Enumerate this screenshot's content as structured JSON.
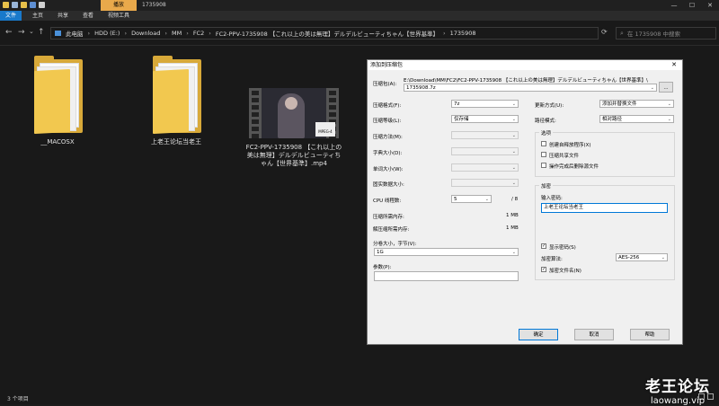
{
  "titlebar": {
    "context_tab": "播放",
    "title": "1735908",
    "minimize": "—",
    "maximize": "☐",
    "close": "✕"
  },
  "ribbon": {
    "tabs": [
      "文件",
      "主页",
      "共享",
      "查看",
      "视频工具"
    ]
  },
  "navigation": {
    "back": "←",
    "forward": "→",
    "recent": "⌄",
    "up": "↑",
    "refresh": "⟳",
    "breadcrumb": [
      "此电脑",
      "HDD (E:)",
      "Download",
      "MM",
      "FC2",
      "FC2-PPV-1735908 【これ以上の美は無理】デルデルビューティちゃん【世界基準】",
      "1735908"
    ],
    "search_placeholder": "在 1735908 中搜索"
  },
  "files": [
    {
      "name": "__MACOSX",
      "type": "folder"
    },
    {
      "name": "上老王论坛当老王",
      "type": "folder"
    },
    {
      "name": "FC2-PPV-1735908 【これ以上の美は無理】デルデルビューティちゃん【世界基準】.mp4",
      "type": "video",
      "badge": "MPEG-4"
    }
  ],
  "status": {
    "count": "3 个项目"
  },
  "watermark": {
    "line1": "老王论坛",
    "line2": "laowang.vip"
  },
  "dialog": {
    "title": "添加到压缩包",
    "close": "✕",
    "archive_label": "压缩包(A):",
    "archive_path": "E:\\Download\\MM\\FC2\\FC2-PPV-1735908 【これ以上の美は無理】デルデルビューティちゃん【世界基準】\\",
    "archive_name": "1735908.7z",
    "browse": "...",
    "fields": [
      {
        "label": "压缩格式(F):",
        "value": "7z"
      },
      {
        "label": "压缩等级(L):",
        "value": "仅存储"
      },
      {
        "label": "压缩方法(M):",
        "value": ""
      },
      {
        "label": "字典大小(D):",
        "value": ""
      },
      {
        "label": "单词大小(W):",
        "value": ""
      },
      {
        "label": "固实数据大小:",
        "value": ""
      }
    ],
    "cpu_label": "CPU 线程数:",
    "cpu_value": "5",
    "cpu_total": "/ 8",
    "mem_compress_label": "压缩所需内存:",
    "mem_compress_value": "1 MB",
    "mem_decompress_label": "解压缩所需内存:",
    "mem_decompress_value": "1 MB",
    "split_label": "分卷大小，字节(V):",
    "split_value": "1G",
    "params_label": "参数(P):",
    "params_value": "",
    "update_label": "更新方式(U):",
    "update_value": "添加并替换文件",
    "pathmode_label": "路径模式:",
    "pathmode_value": "相对路径",
    "options_title": "选项",
    "options": [
      {
        "label": "创建自释放程序(X)",
        "checked": false
      },
      {
        "label": "压缩共享文件",
        "checked": false
      },
      {
        "label": "操作完成后删除源文件",
        "checked": false
      }
    ],
    "encrypt_title": "加密",
    "password_label": "输入密码:",
    "password_value": "上老王论坛当老王",
    "show_password": {
      "label": "显示密码(S)",
      "checked": true
    },
    "method_label": "加密算法:",
    "method_value": "AES-256",
    "encrypt_names": {
      "label": "加密文件名(N)",
      "checked": true
    },
    "check_mark": "✓",
    "ok": "确定",
    "cancel": "取消",
    "help": "帮助"
  }
}
